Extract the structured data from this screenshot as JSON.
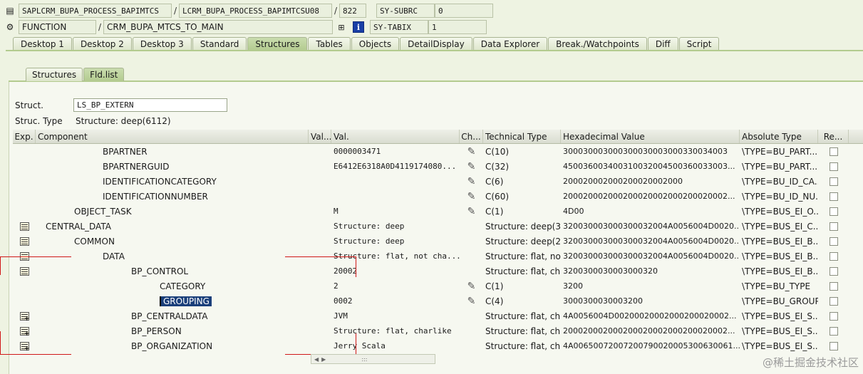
{
  "header": {
    "program": "SAPLCRM_BUPA_PROCESS_BAPIMTCS",
    "include": "LCRM_BUPA_PROCESS_BAPIMTCSU08",
    "line": "822",
    "sy_subrc_label": "SY-SUBRC",
    "sy_subrc_value": "0",
    "event_type": "FUNCTION",
    "event_name": "CRM_BUPA_MTCS_TO_MAIN",
    "sy_tabix_label": "SY-TABIX",
    "sy_tabix_value": "1",
    "separator": "/"
  },
  "tabs": [
    "Desktop 1",
    "Desktop 2",
    "Desktop 3",
    "Standard",
    "Structures",
    "Tables",
    "Objects",
    "DetailDisplay",
    "Data Explorer",
    "Break./Watchpoints",
    "Diff",
    "Script"
  ],
  "active_tab": "Structures",
  "subtabs": [
    "Structures",
    "Fld.list"
  ],
  "active_subtab": "Fld.list",
  "struct": {
    "label": "Struct.",
    "value": "LS_BP_EXTERN",
    "type_label": "Struc. Type",
    "type_value": "Structure: deep(6112)"
  },
  "columns": [
    "Exp.",
    "Component",
    "Val...",
    "Val.",
    "Ch...",
    "Technical Type",
    "Hexadecimal Value",
    "Absolute Type",
    "Re..."
  ],
  "rows": [
    {
      "component": "BPARTNER",
      "value": "0000003471",
      "change": true,
      "tech": "C(10)",
      "hex": "300030003000300030003000330034003",
      "abs": "\\TYPE=BU_PART..."
    },
    {
      "component": "BPARTNERGUID",
      "value": "E6412E6318A0D4119174080...",
      "change": true,
      "tech": "C(32)",
      "hex": "450036003400310032004500360033003...",
      "abs": "\\TYPE=BU_PART..."
    },
    {
      "component": "IDENTIFICATIONCATEGORY",
      "value": "",
      "change": true,
      "tech": "C(6)",
      "hex": "200020002000200020002000",
      "abs": "\\TYPE=BU_ID_CA..."
    },
    {
      "component": "IDENTIFICATIONNUMBER",
      "value": "",
      "change": true,
      "tech": "C(60)",
      "hex": "200020002000200020002000200020002...",
      "abs": "\\TYPE=BU_ID_NU..."
    },
    {
      "component": "OBJECT_TASK",
      "value": "M",
      "change": true,
      "tech": "C(1)",
      "hex": "4D00",
      "abs": "\\TYPE=BUS_EI_O..."
    },
    {
      "component": "CENTRAL_DATA",
      "value": "Structure: deep",
      "change": false,
      "tech": "Structure: deep(3...",
      "hex": "320030003000300032004A0056004D0020...",
      "abs": "\\TYPE=BUS_EI_C..."
    },
    {
      "component": "COMMON",
      "value": "Structure: deep",
      "change": false,
      "tech": "Structure: deep(2...",
      "hex": "320030003000300032004A0056004D0020...",
      "abs": "\\TYPE=BUS_EI_B..."
    },
    {
      "component": "DATA",
      "value": "Structure: flat, not cha...",
      "change": false,
      "tech": "Structure: flat, no...",
      "hex": "320030003000300032004A0056004D0020...",
      "abs": "\\TYPE=BUS_EI_B..."
    },
    {
      "component": "BP_CONTROL",
      "value": "20002",
      "change": false,
      "tech": "Structure: flat, ch...",
      "hex": "3200300030003000320",
      "abs": "\\TYPE=BUS_EI_B..."
    },
    {
      "component": "CATEGORY",
      "value": "2",
      "change": true,
      "tech": "C(1)",
      "hex": "3200",
      "abs": "\\TYPE=BU_TYPE"
    },
    {
      "component": "GROUPING",
      "value": "0002",
      "change": true,
      "tech": "C(4)",
      "hex": "3000300030003200",
      "abs": "\\TYPE=BU_GROUP"
    },
    {
      "component": "BP_CENTRALDATA",
      "value": "JVM",
      "change": false,
      "tech": "Structure: flat, ch...",
      "hex": "4A0056004D00200020002000200020002...",
      "abs": "\\TYPE=BUS_EI_S..."
    },
    {
      "component": "BP_PERSON",
      "value": "Structure: flat, charlike",
      "change": false,
      "tech": "Structure: flat, ch...",
      "hex": "200020002000200020002000200020002...",
      "abs": "\\TYPE=BUS_EI_S..."
    },
    {
      "component": "BP_ORGANIZATION",
      "value": "Jerry Scala",
      "change": false,
      "tech": "Structure: flat, ch...",
      "hex": "4A00650072007200790020005300630061...",
      "abs": "\\TYPE=BUS_EI_S..."
    }
  ],
  "watermark": "@稀土掘金技术社区",
  "colors": {
    "accent": "#b3cb8f",
    "selection": "#1a3f7a",
    "marker": "#d01818"
  }
}
